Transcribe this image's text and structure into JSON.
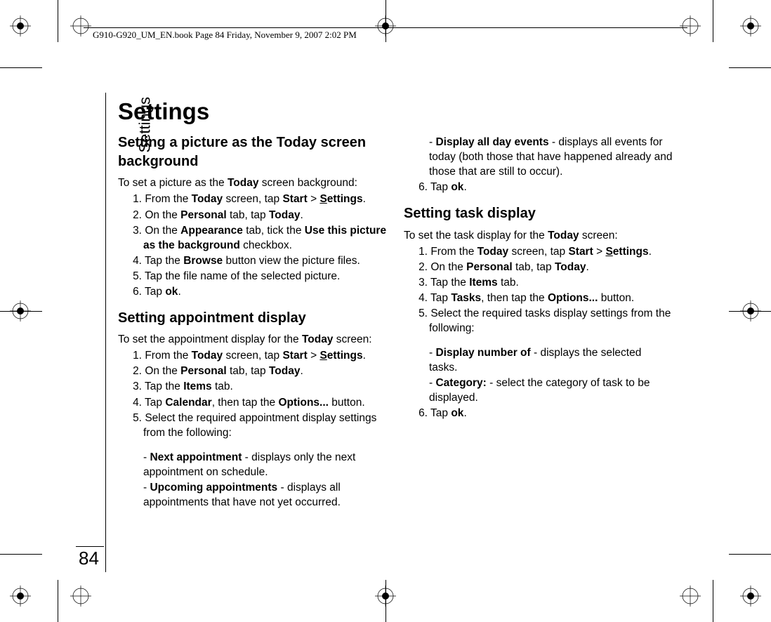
{
  "header": "G910-G920_UM_EN.book  Page 84  Friday, November 9, 2007  2:02 PM",
  "sidebar": "Settings",
  "pageNumber": "84",
  "title": "Settings",
  "col1": {
    "sec1": {
      "heading": "Setting a picture as the Today screen background",
      "intro_pre": "To set a picture as the ",
      "intro_b1": "Today",
      "intro_post": " screen background:",
      "s1_a": "From the ",
      "s1_b1": "Today",
      "s1_c": " screen, tap ",
      "s1_b2": "Start",
      "s1_d": " > ",
      "s1_b3": "Settings",
      "s1_e": ".",
      "s2_a": "On the ",
      "s2_b1": "Personal",
      "s2_c": " tab, tap ",
      "s2_b2": "Today",
      "s2_d": ".",
      "s3_a": "On the ",
      "s3_b1": "Appearance",
      "s3_c": " tab, tick the ",
      "s3_b2": "Use this picture as the background",
      "s3_d": " checkbox.",
      "s4_a": "Tap the ",
      "s4_b1": "Browse",
      "s4_c": " button view the picture files.",
      "s5": "Tap the file name of the selected picture.",
      "s6_a": "Tap ",
      "s6_b1": "ok",
      "s6_c": "."
    },
    "sec2": {
      "heading": "Setting appointment display",
      "intro_a": "To set the appointment display for the ",
      "intro_b": "Today",
      "intro_c": " screen:",
      "s1_a": "From the ",
      "s1_b1": "Today",
      "s1_c": " screen, tap ",
      "s1_b2": "Start",
      "s1_d": " > ",
      "s1_b3": "Settings",
      "s1_e": ".",
      "s2_a": "On the ",
      "s2_b1": "Personal",
      "s2_c": " tab, tap ",
      "s2_b2": "Today",
      "s2_d": ".",
      "s3_a": "Tap the ",
      "s3_b1": "Items",
      "s3_c": " tab.",
      "s4_a": "Tap ",
      "s4_b1": "Calendar",
      "s4_c": ", then tap the ",
      "s4_b2": "Options...",
      "s4_d": " button.",
      "s5": "Select the required appointment display settings from the following:",
      "opt1_a": "- ",
      "opt1_b": "Next appointment",
      "opt1_c": " - displays only the next appointment on schedule.",
      "opt2_a": "- ",
      "opt2_b": "Upcoming appointments",
      "opt2_c": " - displays all appointments that have not yet occurred."
    }
  },
  "col2": {
    "cont": {
      "opt3_a": "- ",
      "opt3_b": "Display all day events",
      "opt3_c": " - displays all events for today (both those that have happened already and those that are still to occur).",
      "s6_a": "Tap ",
      "s6_b1": "ok",
      "s6_c": "."
    },
    "sec3": {
      "heading": "Setting task display",
      "intro_a": "To set the task display for the ",
      "intro_b": "Today",
      "intro_c": " screen:",
      "s1_a": "From the ",
      "s1_b1": "Today",
      "s1_c": " screen, tap ",
      "s1_b2": "Start",
      "s1_d": " > ",
      "s1_b3": "Settings",
      "s1_e": ".",
      "s2_a": "On the ",
      "s2_b1": "Personal",
      "s2_c": " tab, tap ",
      "s2_b2": "Today",
      "s2_d": ".",
      "s3_a": "Tap the ",
      "s3_b1": "Items",
      "s3_c": " tab.",
      "s4_a": "Tap ",
      "s4_b1": "Tasks",
      "s4_c": ", then tap the ",
      "s4_b2": "Options...",
      "s4_d": " button.",
      "s5": "Select the required tasks display settings from the following:",
      "opt1_a": "- ",
      "opt1_b": "Display number of",
      "opt1_c": " - displays the selected tasks.",
      "opt2_a": "- ",
      "opt2_b": "Category:",
      "opt2_c": " - select the category of task to be displayed.",
      "s6_a": "Tap ",
      "s6_b1": "ok",
      "s6_c": "."
    }
  }
}
